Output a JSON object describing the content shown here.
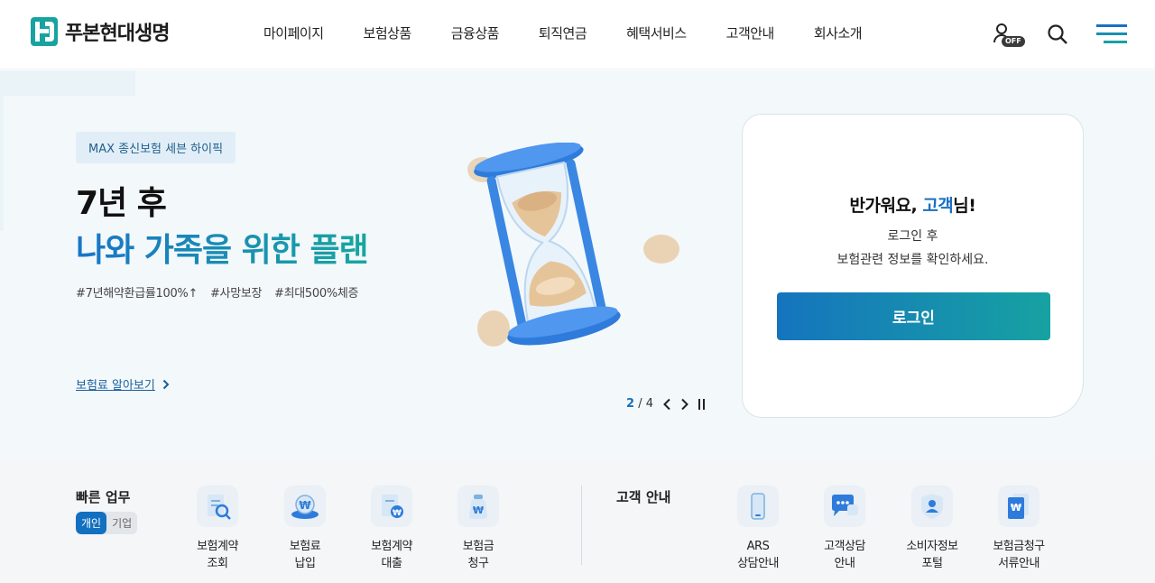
{
  "header": {
    "brand": "푸본현대생명",
    "nav": [
      "마이페이지",
      "보험상품",
      "금융상품",
      "퇴직연금",
      "혜택서비스",
      "고객안내",
      "회사소개"
    ],
    "off_badge": "OFF",
    "icons": [
      "user-icon",
      "search-icon",
      "menu-icon"
    ]
  },
  "hero": {
    "tag": "MAX 종신보험 세븐 하이픽",
    "title_line1": "7년 후",
    "title_line2": "나와 가족을 위한 플랜",
    "hashtags": [
      "#7년해약환급률100%↑",
      "#사망보장",
      "#최대500%체증"
    ],
    "link_label": "보험료 알아보기",
    "pager": {
      "current": "2",
      "total": "4",
      "separator": "/"
    }
  },
  "login": {
    "greeting_prefix": "반가워요, ",
    "greeting_name": "고객",
    "greeting_suffix": "님!",
    "message_line1": "로그인 후",
    "message_line2": "보험관련 정보를 확인하세요.",
    "button_label": "로그인"
  },
  "quick": {
    "title": "빠른 업무",
    "toggle": [
      "개인",
      "기업"
    ],
    "items": [
      "보험계약\n조회",
      "보험료\n납입",
      "보험계약\n대출",
      "보험금\n청구"
    ],
    "cs_title": "고객 안내",
    "cs_items": [
      "ARS\n상담안내",
      "고객상담\n안내",
      "소비자정보\n포털",
      "보험금청구\n서류안내"
    ]
  },
  "colors": {
    "primary": "#1a6fc2",
    "teal": "#17a2a2",
    "hero_bg": "#f3f8fb"
  }
}
